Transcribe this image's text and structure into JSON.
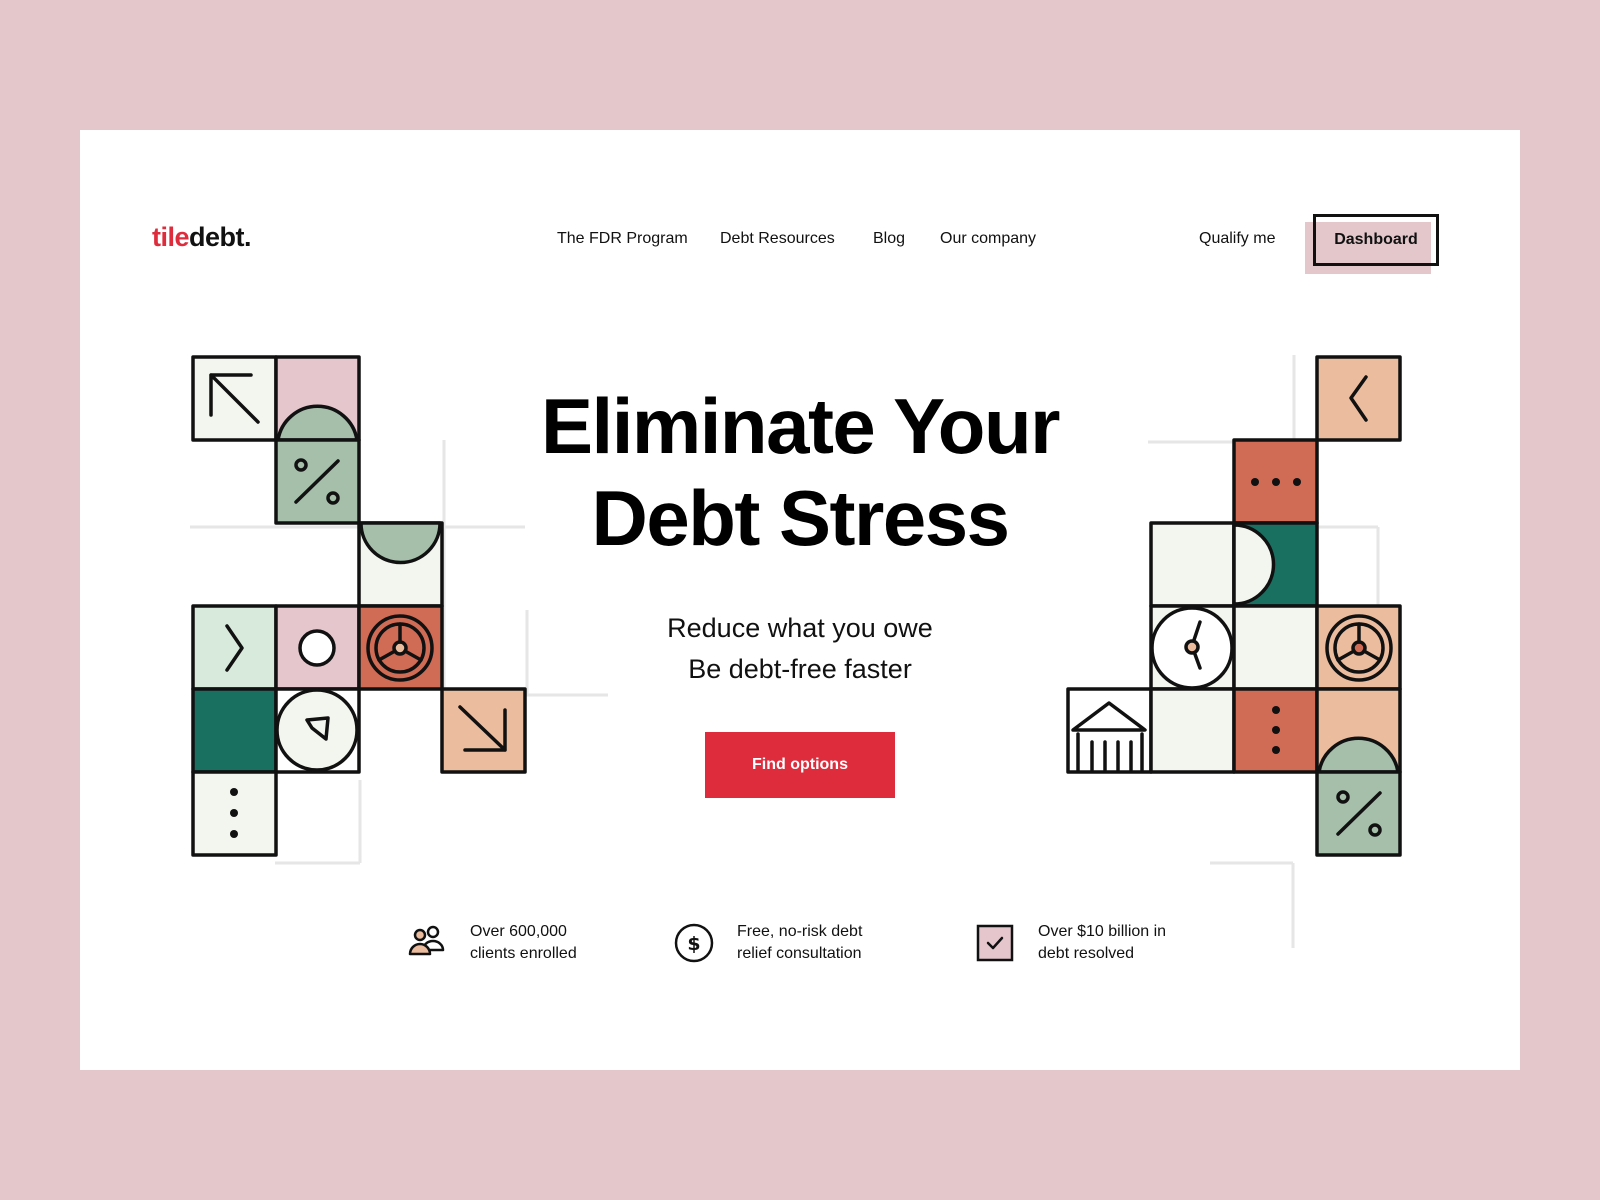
{
  "brand": {
    "logo_part1": "tile",
    "logo_part2": "debt."
  },
  "nav": {
    "items": [
      {
        "label": "The FDR Program"
      },
      {
        "label": "Debt Resources"
      },
      {
        "label": "Blog"
      },
      {
        "label": "Our company"
      }
    ],
    "qualify_label": "Qualify me",
    "dashboard_label": "Dashboard"
  },
  "hero": {
    "title_line1": "Eliminate Your",
    "title_line2": "Debt Stress",
    "subtitle_line1": "Reduce what you owe",
    "subtitle_line2": "Be debt-free faster",
    "cta_label": "Find options"
  },
  "features": [
    {
      "icon": "people-icon",
      "line1": "Over 600,000",
      "line2": "clients enrolled"
    },
    {
      "icon": "dollar-coin-icon",
      "line1": "Free, no-risk debt",
      "line2": "relief consultation"
    },
    {
      "icon": "checkbox-icon",
      "line1": "Over $10 billion in",
      "line2": "debt resolved"
    }
  ],
  "colors": {
    "background": "#e3c7cb",
    "card": "#ffffff",
    "brand_red": "#de2c3c",
    "sage": "#a5bfaa",
    "mint": "#d7eadb",
    "pink": "#e4c6cc",
    "teal": "#1a7060",
    "terracotta": "#d06b55",
    "peach": "#ebbc9e",
    "cream": "#f3f6ee",
    "ink": "#111111"
  }
}
